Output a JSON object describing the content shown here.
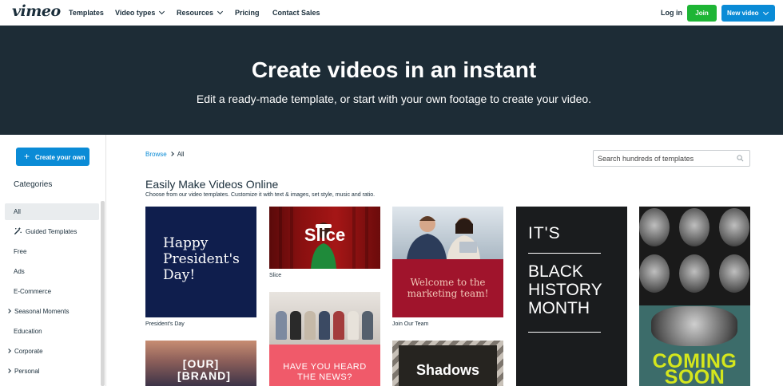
{
  "nav": {
    "logo": "vimeo",
    "items": [
      "Templates",
      "Video types",
      "Resources",
      "Pricing",
      "Contact Sales"
    ],
    "login": "Log in",
    "join": "Join",
    "new_video": "New video"
  },
  "hero": {
    "title": "Create videos in an instant",
    "subtitle": "Edit a ready-made template, or start with your own footage to create your video."
  },
  "sidebar": {
    "create_button": "Create your own",
    "categories_heading": "Categories",
    "categories": [
      "All",
      "Guided Templates",
      "Free",
      "Ads",
      "E-Commerce",
      "Seasonal Moments",
      "Education",
      "Corporate",
      "Personal"
    ]
  },
  "main": {
    "breadcrumb": {
      "link": "Browse",
      "current": "All"
    },
    "search_placeholder": "Search hundreds of templates",
    "title": "Easily Make Videos Online",
    "subtitle": "Choose from our video templates. Customize it with text & images, set style, music and ratio."
  },
  "templates": {
    "presidents": {
      "art": "Happy President's Day!",
      "label": "President's Day"
    },
    "slice": {
      "art": "Slice",
      "label": "Slice"
    },
    "team": {
      "art": "Welcome to the marketing team!",
      "label": "Join Our Team"
    },
    "bhm": {
      "art_top": "IT'S",
      "art_main": "BLACK HISTORY MONTH"
    },
    "coming": {
      "art": "COMING SOON"
    },
    "brand": {
      "art": "[OUR] [BRAND]"
    },
    "news": {
      "art": "HAVE YOU HEARD THE NEWS?"
    },
    "shadows": {
      "art": "Shadows"
    }
  },
  "colors": {
    "hero_bg": "#1d2c36",
    "join_green": "#1eb535",
    "accent_blue": "#0a8bd6"
  }
}
